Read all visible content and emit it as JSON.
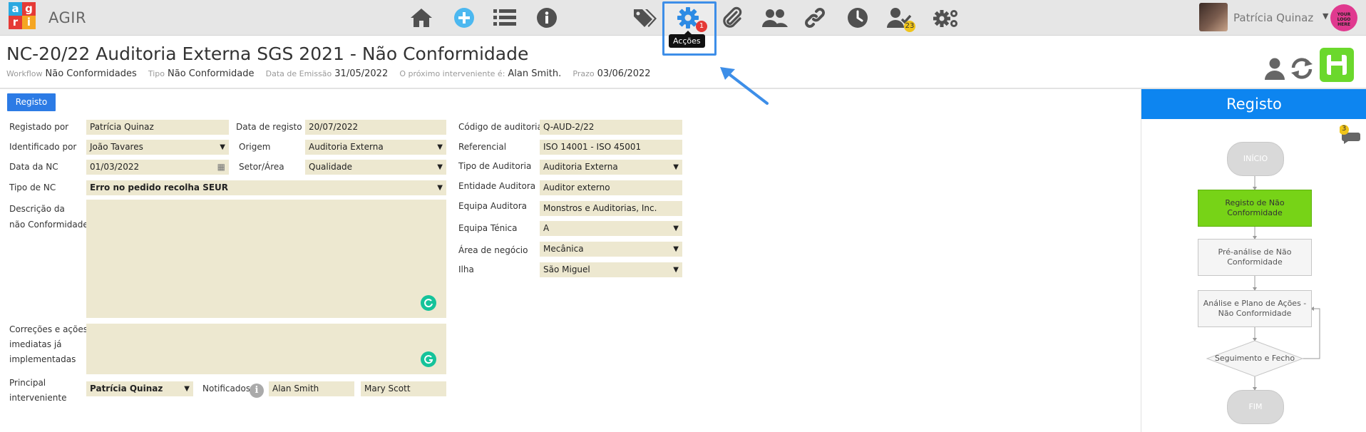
{
  "app": {
    "name": "AGIR"
  },
  "toolbar": {
    "actions_badge": "1",
    "actions_tooltip": "Acções",
    "approvals_badge": "23"
  },
  "user": {
    "name": "Patrícia Quinaz",
    "company_logo_text": "YOUR LOGO HERE"
  },
  "page": {
    "title": "NC-20/22 Auditoria Externa SGS 2021 - Não Conformidade",
    "meta": {
      "workflow_label": "Workflow",
      "workflow_value": "Não Conformidades",
      "tipo_label": "Tipo",
      "tipo_value": "Não Conformidade",
      "emissao_label": "Data de Emissão",
      "emissao_value": "31/05/2022",
      "interveniente_label": "O próximo interveniente é:",
      "interveniente_value": "Alan Smith.",
      "prazo_label": "Prazo",
      "prazo_value": "03/06/2022"
    }
  },
  "form": {
    "tab": "Registo",
    "registado_por": {
      "label": "Registado por",
      "value": "Patrícia Quinaz"
    },
    "data_registo": {
      "label": "Data de registo",
      "value": "20/07/2022"
    },
    "identificado_por": {
      "label": "Identificado por",
      "value": "João Tavares"
    },
    "origem": {
      "label": "Origem",
      "value": "Auditoria Externa"
    },
    "data_nc": {
      "label": "Data da NC",
      "value": "01/03/2022"
    },
    "setor": {
      "label": "Setor/Área",
      "value": "Qualidade"
    },
    "tipo_nc": {
      "label": "Tipo de NC",
      "value": "Erro no pedido recolha SEUR"
    },
    "descricao": {
      "label_line1": "Descrição da",
      "label_line2": "não Conformidade"
    },
    "correcoes": {
      "label_line1": "Correções e ações",
      "label_line2": "imediatas já",
      "label_line3": "implementadas"
    },
    "principal": {
      "label_line1": "Principal",
      "label_line2": "interveniente",
      "value": "Patrícia Quinaz"
    },
    "notificados": {
      "label": "Notificados",
      "values": [
        "Alan Smith",
        "Mary Scott"
      ]
    },
    "codigo_auditoria": {
      "label": "Código de auditoria",
      "value": "Q-AUD-2/22"
    },
    "referencial": {
      "label": "Referencial",
      "value": "ISO 14001 - ISO 45001"
    },
    "tipo_auditoria": {
      "label": "Tipo de Auditoria",
      "value": "Auditoria Externa"
    },
    "entidade_auditora": {
      "label": "Entidade Auditora",
      "value": "Auditor externo"
    },
    "equipa_auditora": {
      "label": "Equipa Auditora",
      "value": "Monstros e Auditorias, Inc."
    },
    "equipa_tecnica": {
      "label": "Equipa Ténica",
      "value": "A"
    },
    "area_negocio": {
      "label": "Área de negócio",
      "value": "Mecânica"
    },
    "ilha": {
      "label": "Ilha",
      "value": "São Miguel"
    }
  },
  "workflow": {
    "header": "Registo",
    "comments_badge": "3",
    "nodes": {
      "start": "INÍCIO",
      "registo": "Registo de Não Conformidade",
      "pre_analise": "Pré-análise de Não Conformidade",
      "analise": "Análise e Plano de Ações - Não Conformidade",
      "seguimento": "Seguimento e Fecho",
      "end": "FIM"
    }
  },
  "colors": {
    "accent": "#2c7be5",
    "active_step": "#77d317",
    "save_button": "#6bd82c",
    "field_bg": "#ede8d0"
  }
}
